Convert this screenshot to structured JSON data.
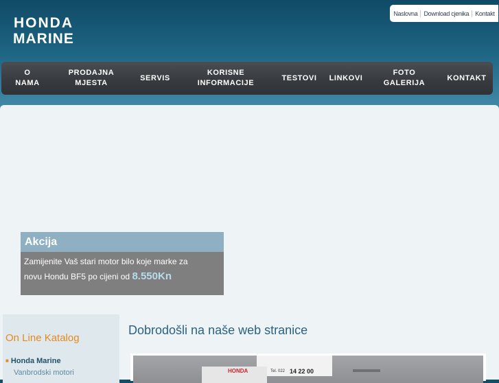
{
  "brand": {
    "line1": "HONDA",
    "line2": "MARINE"
  },
  "top_links": [
    "Naslovna",
    "Download cjenika",
    "Kontakt"
  ],
  "nav": [
    {
      "label": "O\nNAMA"
    },
    {
      "label": "PRODAJNA\nMJESTA"
    },
    {
      "label": "SERVIS"
    },
    {
      "label": "KORISNE\nINFORMACIJE"
    },
    {
      "label": "TESTOVI"
    },
    {
      "label": "LINKOVI"
    },
    {
      "label": "FOTO\nGALERIJA"
    },
    {
      "label": "KONTAKT"
    }
  ],
  "promo": {
    "title": "Akcija",
    "line1": "Zamijenite Vaš stari motor bilo koje marke za",
    "line2": "novu Hondu BF5 po cijeni od",
    "price": "8.550Kn"
  },
  "sidebar": {
    "title": "On Line Katalog",
    "item": "Honda Marine",
    "sub": "Vanbrodski motori"
  },
  "main": {
    "welcome": "Dobrodošli na naše web stranice"
  },
  "photo_sign": {
    "brand": "HONDA",
    "tel": "Tel. 022",
    "phone": "14 22 00"
  }
}
